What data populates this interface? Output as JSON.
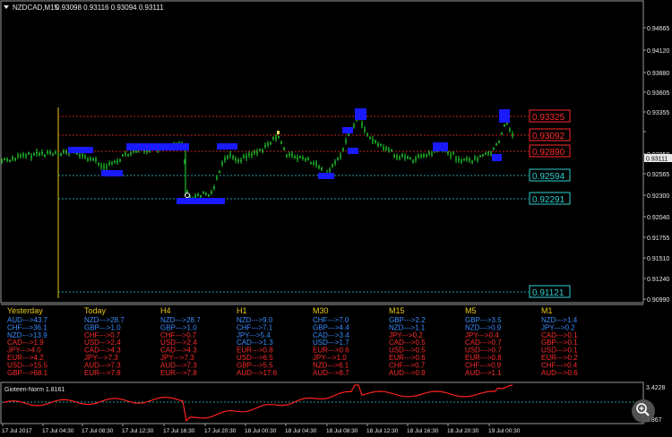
{
  "header": {
    "symbol_timeframe": "NZDCAD,M15",
    "ohlc": "0.93098 0.93116 0.93094 0.93111"
  },
  "price_axis": {
    "ticks": [
      "0.94665",
      "0.94120",
      "0.93880",
      "0.93605",
      "0.93355",
      "0.93111",
      "0.92850",
      "0.92565",
      "0.92300",
      "0.92040",
      "0.91755",
      "0.91510",
      "0.91240",
      "0.90990"
    ],
    "current_price": "0.93111"
  },
  "levels": [
    {
      "label": "0.93325",
      "color": "#ff2a2a"
    },
    {
      "label": "0.93092",
      "color": "#ff2a2a"
    },
    {
      "label": "0.92890",
      "color": "#ff2a2a"
    },
    {
      "label": "0.92594",
      "color": "#2fd0d0"
    },
    {
      "label": "0.92291",
      "color": "#2fd0d0"
    },
    {
      "label": "0.91121",
      "color": "#2fd0d0"
    }
  ],
  "strength_table": {
    "columns": [
      {
        "header": "Yesterday",
        "rows": [
          {
            "text": "AUD--->43.7",
            "color": "#3a8cff"
          },
          {
            "text": "CHF--->36.1",
            "color": "#3a8cff"
          },
          {
            "text": "NZD--->13.9",
            "color": "#3a8cff"
          },
          {
            "text": "CAD--->1.9",
            "color": "#ff2a2a"
          },
          {
            "text": "JPY--->4.0",
            "color": "#ff2a2a"
          },
          {
            "text": "EUR--->4.2",
            "color": "#ff2a2a"
          },
          {
            "text": "USD--->15.5",
            "color": "#ff2a2a"
          },
          {
            "text": "GBP--->68.1",
            "color": "#ff2a2a"
          }
        ]
      },
      {
        "header": "Today",
        "rows": [
          {
            "text": "NZD--->28.7",
            "color": "#3a8cff"
          },
          {
            "text": "GBP--->1.0",
            "color": "#3a8cff"
          },
          {
            "text": "CHF--->0.7",
            "color": "#ff2a2a"
          },
          {
            "text": "USD--->2.4",
            "color": "#ff2a2a"
          },
          {
            "text": "CAD--->4.3",
            "color": "#ff2a2a"
          },
          {
            "text": "JPY--->7.3",
            "color": "#ff2a2a"
          },
          {
            "text": "AUD--->7.3",
            "color": "#ff2a2a"
          },
          {
            "text": "EUR--->7.8",
            "color": "#ff2a2a"
          }
        ]
      },
      {
        "header": "H4",
        "rows": [
          {
            "text": "NZD--->28.7",
            "color": "#3a8cff"
          },
          {
            "text": "GBP--->1.0",
            "color": "#3a8cff"
          },
          {
            "text": "CHF--->0.7",
            "color": "#ff2a2a"
          },
          {
            "text": "USD--->2.4",
            "color": "#ff2a2a"
          },
          {
            "text": "CAD--->4.3",
            "color": "#ff2a2a"
          },
          {
            "text": "JPY--->7.3",
            "color": "#ff2a2a"
          },
          {
            "text": "AUD--->7.3",
            "color": "#ff2a2a"
          },
          {
            "text": "EUR--->7.8",
            "color": "#ff2a2a"
          }
        ]
      },
      {
        "header": "H1",
        "rows": [
          {
            "text": "NZD--->9.0",
            "color": "#3a8cff"
          },
          {
            "text": "CHF--->7.1",
            "color": "#3a8cff"
          },
          {
            "text": "JPY--->5.4",
            "color": "#3a8cff"
          },
          {
            "text": "CAD--->1.3",
            "color": "#3a8cff"
          },
          {
            "text": "EUR--->0.8",
            "color": "#ff2a2a"
          },
          {
            "text": "USD--->6.5",
            "color": "#ff2a2a"
          },
          {
            "text": "GBP--->5.5",
            "color": "#ff2a2a"
          },
          {
            "text": "AUD--->17.6",
            "color": "#ff2a2a"
          }
        ]
      },
      {
        "header": "M30",
        "rows": [
          {
            "text": "CHF--->7.0",
            "color": "#3a8cff"
          },
          {
            "text": "GBP--->4.4",
            "color": "#3a8cff"
          },
          {
            "text": "CAD--->3.4",
            "color": "#3a8cff"
          },
          {
            "text": "USD--->1.7",
            "color": "#3a8cff"
          },
          {
            "text": "EUR--->0.6",
            "color": "#ff2a2a"
          },
          {
            "text": "JPY--->1.0",
            "color": "#ff2a2a"
          },
          {
            "text": "NZD--->6.1",
            "color": "#ff2a2a"
          },
          {
            "text": "AUD--->8.7",
            "color": "#ff2a2a"
          }
        ]
      },
      {
        "header": "M15",
        "rows": [
          {
            "text": "GBP--->2.2",
            "color": "#3a8cff"
          },
          {
            "text": "NZD--->1.1",
            "color": "#3a8cff"
          },
          {
            "text": "JPY--->0.2",
            "color": "#ff2a2a"
          },
          {
            "text": "CAD--->0.5",
            "color": "#ff2a2a"
          },
          {
            "text": "USD--->0.5",
            "color": "#ff2a2a"
          },
          {
            "text": "EUR--->0.6",
            "color": "#ff2a2a"
          },
          {
            "text": "CHF--->0.7",
            "color": "#ff2a2a"
          },
          {
            "text": "AUD--->0.9",
            "color": "#ff2a2a"
          }
        ]
      },
      {
        "header": "M5",
        "rows": [
          {
            "text": "GBP--->3.5",
            "color": "#3a8cff"
          },
          {
            "text": "NZD--->0.9",
            "color": "#3a8cff"
          },
          {
            "text": "JPY--->0.4",
            "color": "#ff2a2a"
          },
          {
            "text": "CAD--->0.7",
            "color": "#ff2a2a"
          },
          {
            "text": "USD--->0.7",
            "color": "#ff2a2a"
          },
          {
            "text": "EUR--->0.8",
            "color": "#ff2a2a"
          },
          {
            "text": "CHF--->0.9",
            "color": "#ff2a2a"
          },
          {
            "text": "AUD--->1.1",
            "color": "#ff2a2a"
          }
        ]
      },
      {
        "header": "M1",
        "rows": [
          {
            "text": "NZD--->1.4",
            "color": "#3a8cff"
          },
          {
            "text": "JPY--->0.2",
            "color": "#3a8cff"
          },
          {
            "text": "CAD--->0.1",
            "color": "#ff2a2a"
          },
          {
            "text": "GBP--->0.1",
            "color": "#ff2a2a"
          },
          {
            "text": "USD--->0.1",
            "color": "#ff2a2a"
          },
          {
            "text": "EUR--->0.2",
            "color": "#ff2a2a"
          },
          {
            "text": "CHF--->0.4",
            "color": "#ff2a2a"
          },
          {
            "text": "AUD--->0.6",
            "color": "#ff2a2a"
          }
        ]
      }
    ]
  },
  "indicator": {
    "name": "Gioteen-Norm 1.8161",
    "value_label": "3.4228",
    "bottom_tick": "1.867"
  },
  "time_axis": {
    "labels": [
      "17 Jul 2017",
      "17 Jul 04:30",
      "17 Jul 08:30",
      "17 Jul 12:30",
      "17 Jul 16:30",
      "17 Jul 20:30",
      "18 Jul 00:30",
      "18 Jul 04:30",
      "18 Jul 08:30",
      "18 Jul 12:30",
      "18 Jul 16:30",
      "18 Jul 20:30",
      "19 Jul 00:30"
    ]
  },
  "colors": {
    "background": "#000000",
    "candle": "#1fbf2a",
    "highlight_box": "#1a1aff",
    "indicator_line": "#ff2020",
    "grid": "#808080",
    "header_text": "#e8e8e8",
    "table_header": "#e8c818"
  },
  "icons": {
    "zoom": "zoom-icon",
    "dropdown": "dropdown-arrow-icon"
  }
}
